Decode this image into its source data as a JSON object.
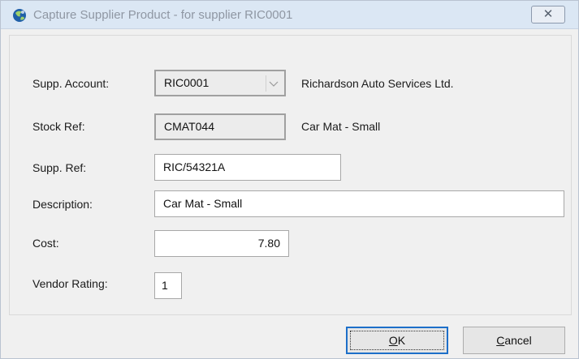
{
  "window": {
    "title": "Capture Supplier Product - for supplier RIC0001",
    "app_icon": "app-globe-icon",
    "close_glyph": "✕",
    "accent": "#1d6fc9"
  },
  "form": {
    "supp_account": {
      "label": "Supp. Account:",
      "value": "RIC0001",
      "name": "Richardson Auto Services Ltd."
    },
    "stock_ref": {
      "label": "Stock Ref:",
      "value": "CMAT044",
      "description": "Car Mat - Small"
    },
    "supp_ref": {
      "label": "Supp. Ref:",
      "value": "RIC/54321A"
    },
    "description": {
      "label": "Description:",
      "value": "Car Mat - Small"
    },
    "cost": {
      "label": "Cost:",
      "value": "7.80"
    },
    "vendor_rating": {
      "label": "Vendor Rating:",
      "value": "1"
    }
  },
  "buttons": {
    "ok": {
      "mnemonic": "O",
      "rest": "K"
    },
    "cancel": {
      "mnemonic": "C",
      "rest": "ancel"
    }
  }
}
